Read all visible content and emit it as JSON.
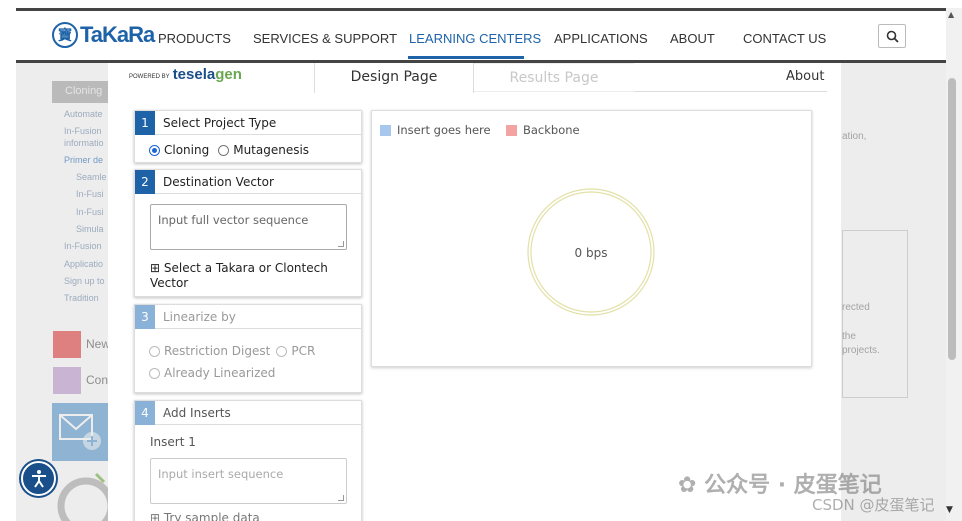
{
  "header": {
    "logo_text": "TaKaRa",
    "nav": [
      "PRODUCTS",
      "SERVICES & SUPPORT",
      "LEARNING CENTERS",
      "APPLICATIONS",
      "ABOUT",
      "CONTACT US"
    ],
    "active_nav": "LEARNING CENTERS",
    "search_icon": "search-icon"
  },
  "background": {
    "sidebar_title": "Cloning",
    "sidebar_links": [
      "Automate",
      "In-Fusion",
      "informatio",
      "Primer de",
      "Seamle",
      "In-Fusi",
      "In-Fusi",
      "Simula",
      "In-Fusion",
      "Applicatio",
      "Sign up to",
      "Tradition"
    ],
    "tiles": [
      "New",
      "Con"
    ],
    "right_texts": [
      "ation,",
      "rected",
      "the",
      "projects."
    ]
  },
  "modal": {
    "powered_by": "POWERED BY",
    "brand_main": "tesela",
    "brand_accent": "gen",
    "tabs": [
      "Design Page",
      "Results Page"
    ],
    "about": "About",
    "panels": {
      "project_type": {
        "step": "1",
        "title": "Select Project Type",
        "options": [
          "Cloning",
          "Mutagenesis"
        ],
        "selected": "Cloning"
      },
      "destination_vector": {
        "step": "2",
        "title": "Destination Vector",
        "placeholder": "Input full vector sequence",
        "link": "⊞ Select a Takara or Clontech Vector"
      },
      "linearize": {
        "step": "3",
        "title": "Linearize by",
        "options": [
          "Restriction Digest",
          "PCR",
          "Already Linearized"
        ]
      },
      "inserts": {
        "step": "4",
        "title": "Add Inserts",
        "insert_label": "Insert 1",
        "placeholder": "Input insert sequence",
        "link": "⊞ Try sample data"
      }
    },
    "visualization": {
      "legend": [
        {
          "label": "Insert goes here",
          "color": "#a7c7ec"
        },
        {
          "label": "Backbone",
          "color": "#f4a3a3"
        }
      ],
      "size_text": "0 bps"
    }
  },
  "watermark": {
    "main": "公众号 · 皮蛋笔记",
    "sub": "CSDN @皮蛋笔记"
  }
}
